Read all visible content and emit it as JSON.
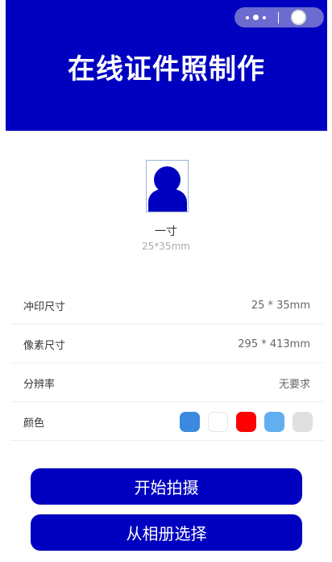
{
  "header": {
    "title": "在线证件照制作"
  },
  "photo": {
    "name": "一寸",
    "dimensions": "25*35mm"
  },
  "specs": [
    {
      "label": "冲印尺寸",
      "value": "25 * 35mm"
    },
    {
      "label": "像素尺寸",
      "value": "295 * 413mm"
    },
    {
      "label": "分辨率",
      "value": "无要求"
    }
  ],
  "color_row": {
    "label": "颜色",
    "colors": [
      "#3b8ae0",
      "#ffffff",
      "#ff0000",
      "#62aff0",
      "#e0e0e0"
    ]
  },
  "buttons": {
    "capture": "开始拍摄",
    "album": "从相册选择"
  },
  "theme": {
    "primary": "#0000c0"
  }
}
